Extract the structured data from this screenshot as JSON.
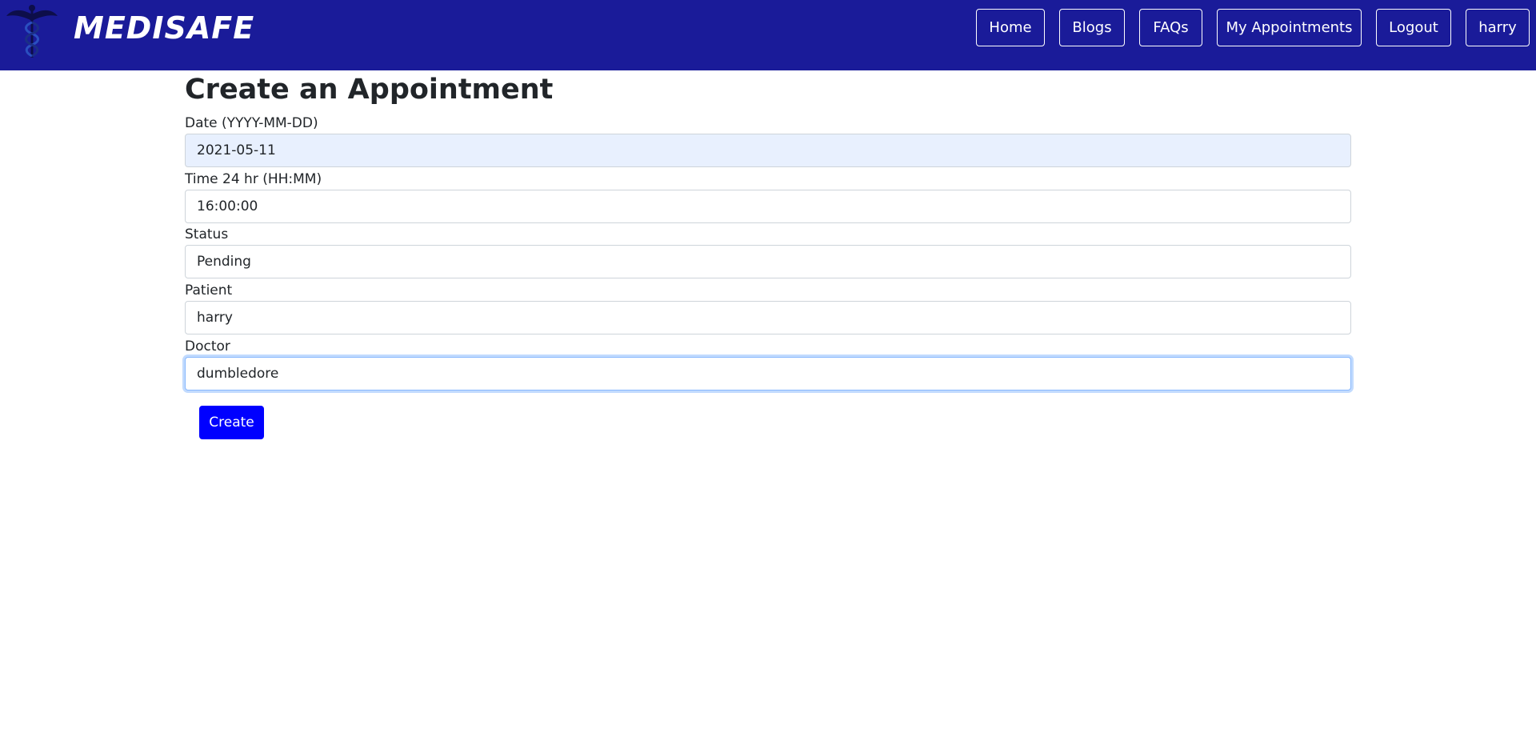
{
  "navbar": {
    "brand": "MEDISAFE",
    "links": [
      "Home",
      "Blogs",
      "FAQs",
      "My Appointments",
      "Logout",
      "harry"
    ]
  },
  "form": {
    "title": "Create an Appointment",
    "date": {
      "label": "Date (YYYY-MM-DD)",
      "value": "2021-05-11"
    },
    "time": {
      "label": "Time 24 hr (HH:MM)",
      "value": "16:00:00"
    },
    "status": {
      "label": "Status",
      "value": "Pending"
    },
    "patient": {
      "label": "Patient",
      "value": "harry"
    },
    "doctor": {
      "label": "Doctor",
      "value": "dumbledore"
    },
    "submit_label": "Create"
  },
  "colors": {
    "navbar": "#1a1b99",
    "create_button": "#0000ff",
    "autofill_background": "#e8f0fe"
  },
  "icons": {
    "logo": "caduceus-logo-icon"
  }
}
